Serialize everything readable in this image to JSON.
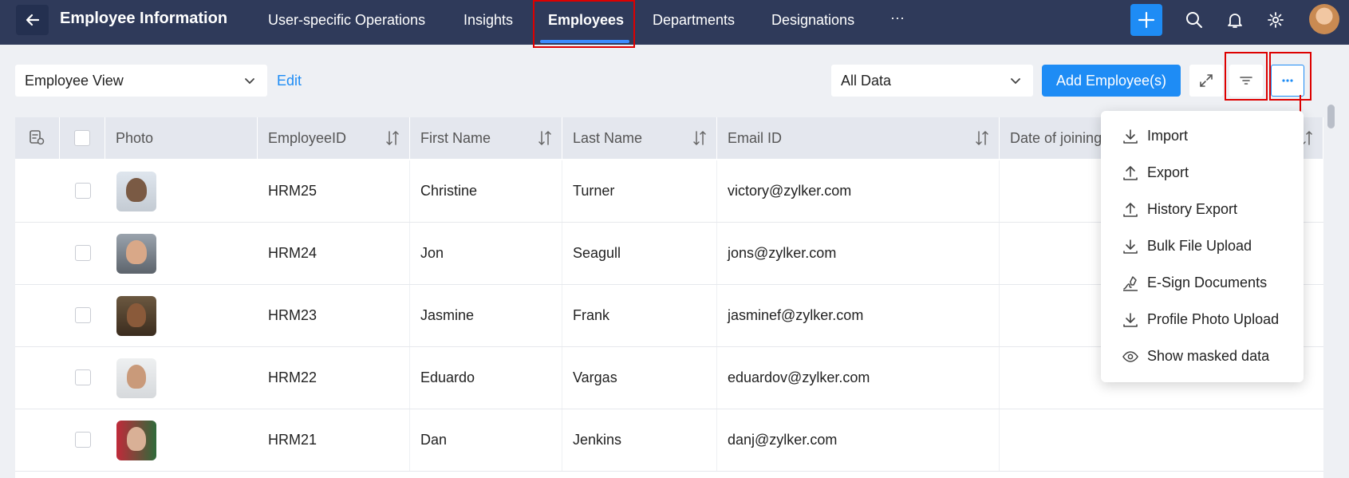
{
  "header": {
    "title": "Employee Information",
    "nav": [
      {
        "label": "User-specific Operations"
      },
      {
        "label": "Insights"
      },
      {
        "label": "Employees",
        "active": true
      },
      {
        "label": "Departments"
      },
      {
        "label": "Designations"
      }
    ],
    "more": "···"
  },
  "toolbar": {
    "view_select": "Employee View",
    "edit_label": "Edit",
    "data_select": "All Data",
    "add_label": "Add Employee(s)"
  },
  "table": {
    "columns": [
      "Photo",
      "EmployeeID",
      "First Name",
      "Last Name",
      "Email ID",
      "Date of joining"
    ],
    "rows": [
      {
        "id": "HRM25",
        "first": "Christine",
        "last": "Turner",
        "email": "victory@zylker.com"
      },
      {
        "id": "HRM24",
        "first": "Jon",
        "last": "Seagull",
        "email": "jons@zylker.com"
      },
      {
        "id": "HRM23",
        "first": "Jasmine",
        "last": "Frank",
        "email": "jasminef@zylker.com"
      },
      {
        "id": "HRM22",
        "first": "Eduardo",
        "last": "Vargas",
        "email": "eduardov@zylker.com"
      },
      {
        "id": "HRM21",
        "first": "Dan",
        "last": "Jenkins",
        "email": "danj@zylker.com"
      }
    ]
  },
  "menu": {
    "items": [
      {
        "label": "Import",
        "icon": "download-icon"
      },
      {
        "label": "Export",
        "icon": "upload-icon"
      },
      {
        "label": "History Export",
        "icon": "upload-icon"
      },
      {
        "label": "Bulk File Upload",
        "icon": "download-icon"
      },
      {
        "label": "E-Sign Documents",
        "icon": "esign-icon"
      },
      {
        "label": "Profile Photo Upload",
        "icon": "download-icon"
      },
      {
        "label": "Show masked data",
        "icon": "eye-icon"
      }
    ]
  },
  "colors": {
    "topbar": "#2f3a5a",
    "accent": "#1e8cf5",
    "highlight": "#dd0000"
  }
}
